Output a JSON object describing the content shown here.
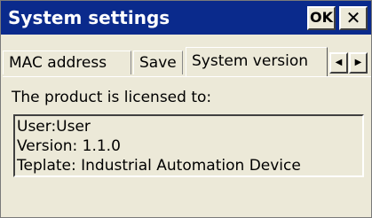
{
  "window": {
    "title": "System settings",
    "ok_label": "OK",
    "close_label": "✕",
    "accent_color": "#0a2a8c"
  },
  "tabs": [
    {
      "label": "MAC address",
      "selected": false
    },
    {
      "label": "Save",
      "selected": false
    },
    {
      "label": "System version",
      "selected": true
    }
  ],
  "tab_scroll": {
    "left_icon": "◀",
    "right_icon": "▶"
  },
  "panel": {
    "licensed_label": "The product is licensed to:",
    "info_lines": [
      "User:User",
      "Version: 1.1.0",
      "Teplate: Industrial Automation Device"
    ]
  }
}
